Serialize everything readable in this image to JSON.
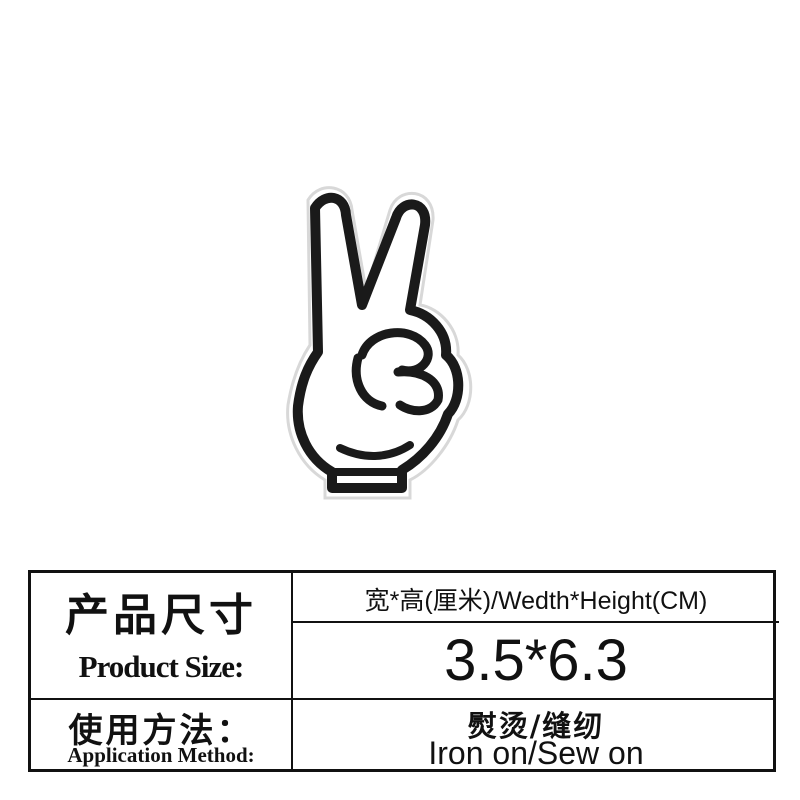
{
  "product_image": {
    "icon": "peace-sign-hand-patch",
    "colors": {
      "fill": "#ffffff",
      "outline": "#1a1a1a"
    }
  },
  "spec_table": {
    "product_size_cn": "产品尺寸",
    "product_size_en": "Product Size:",
    "dimension_label": "宽*高(厘米)/Wedth*Height(CM)",
    "dimension_value": "3.5*6.3",
    "application_cn": "使用方法：",
    "application_en": "Application Method:",
    "method_cn": "熨烫/缝纫",
    "method_en": "Iron on/Sew on"
  }
}
